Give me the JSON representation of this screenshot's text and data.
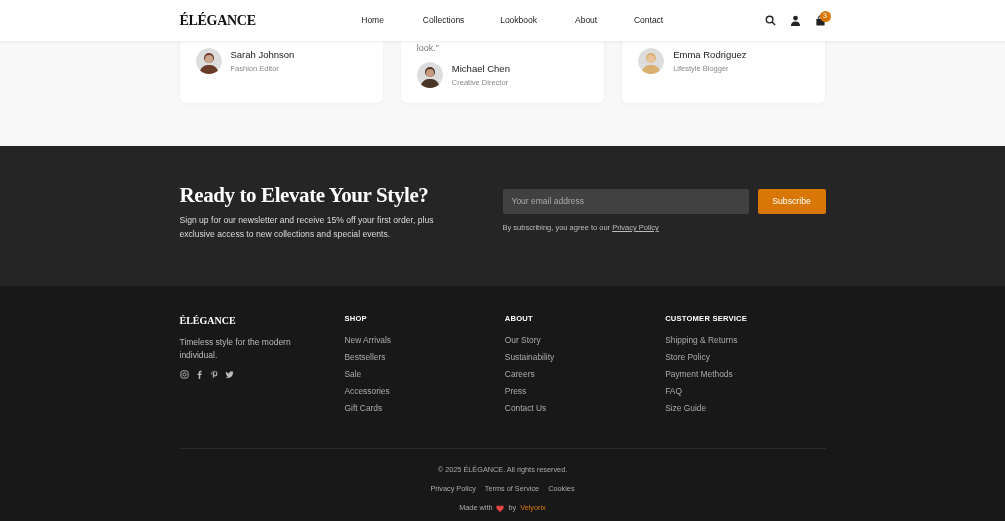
{
  "navbar": {
    "brand": "ÉLÉGANCE",
    "links": [
      {
        "label": "Home"
      },
      {
        "label": "Collections"
      },
      {
        "label": "Lookbook"
      },
      {
        "label": "About"
      },
      {
        "label": "Contact"
      }
    ],
    "cart_count": "3"
  },
  "testimonials": [
    {
      "name": "Sarah Johnson",
      "role": "Fashion Editor"
    },
    {
      "quote": "look.”",
      "name": "Michael Chen",
      "role": "Creative Director"
    },
    {
      "name": "Emma Rodriguez",
      "role": "Lifestyle Blogger"
    }
  ],
  "newsletter": {
    "title": "Ready to Elevate Your Style?",
    "text": "Sign up for our newsletter and receive 15% off your first order, plus exclusive access to new collections and special events.",
    "email": {
      "placeholder": "Your email address"
    },
    "button": "Subscribe",
    "consent": "By subscribing, you agree to our",
    "consent_link": "Privacy Policy"
  },
  "footer": {
    "brand": "ÉLÉGANCE",
    "tagline": "Timeless style for the modern individual.",
    "columns": [
      {
        "title": "SHOP",
        "links": [
          "New Arrivals",
          "Bestsellers",
          "Sale",
          "Accessories",
          "Gift Cards"
        ]
      },
      {
        "title": "ABOUT",
        "links": [
          "Our Story",
          "Sustainability",
          "Careers",
          "Press",
          "Contact Us"
        ]
      },
      {
        "title": "CUSTOMER SERVICE",
        "links": [
          "Shipping & Returns",
          "Store Policy",
          "Payment Methods",
          "FAQ",
          "Size Guide"
        ]
      }
    ],
    "copyright": "© 2025 ÉLÉGANCE. All rights reserved.",
    "legal_links": [
      "Privacy Policy",
      "Terms of Service",
      "Cookies"
    ],
    "made_with": "Made with",
    "by": "by",
    "credit": "Velyorix"
  }
}
